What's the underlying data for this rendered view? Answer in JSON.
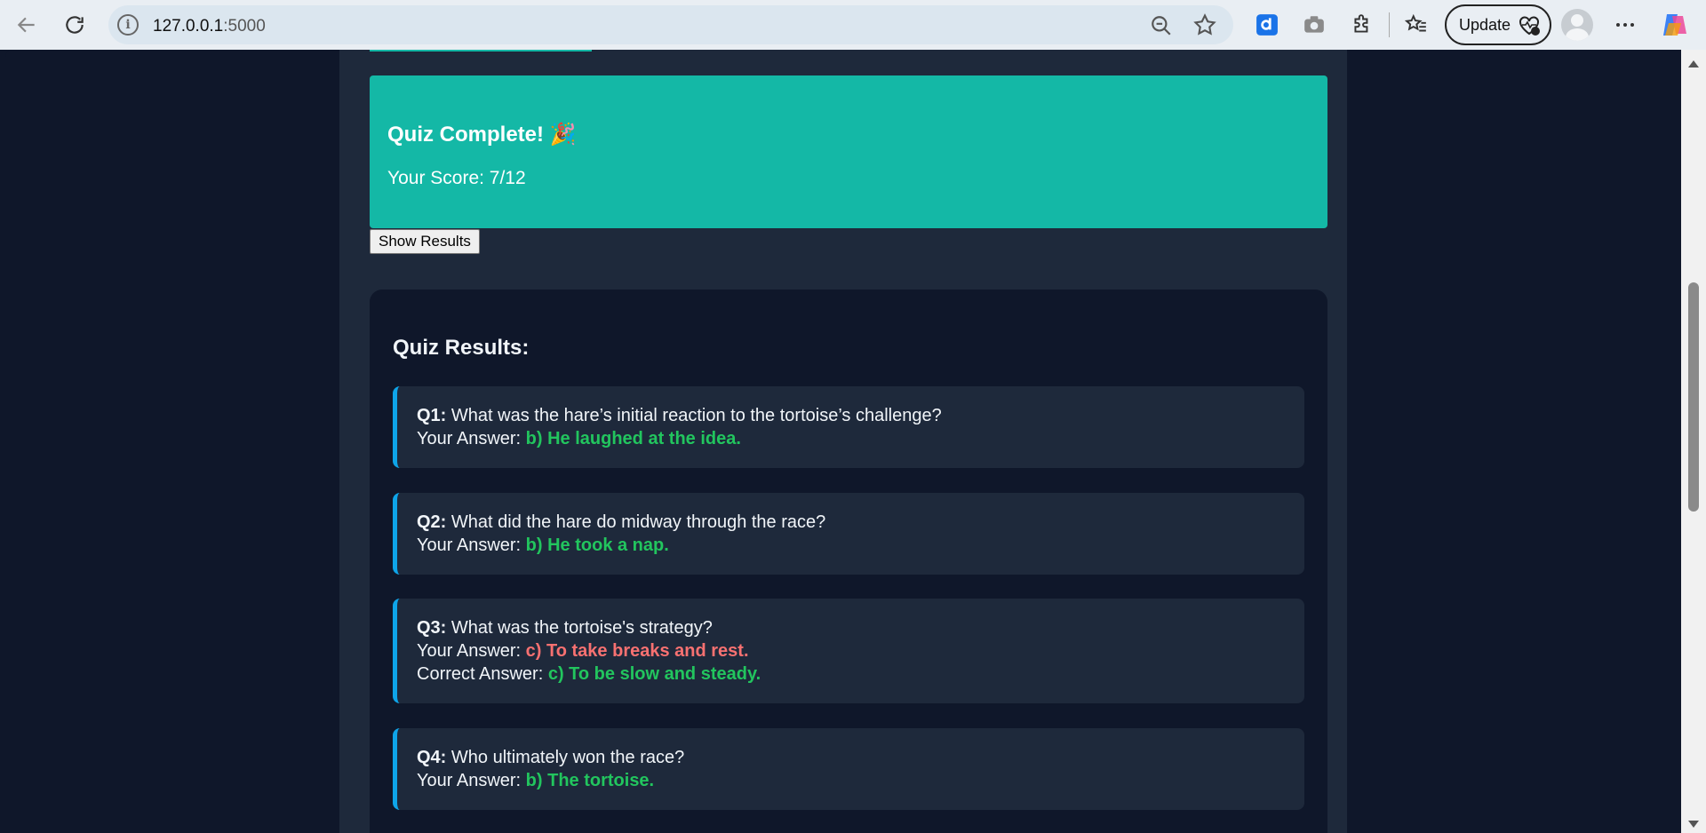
{
  "browser": {
    "url_host": "127.0.0.1",
    "url_port": ":5000",
    "update_label": "Update"
  },
  "quiz": {
    "complete_title": "Quiz Complete! 🎉",
    "score_text": "Your Score: 7/12",
    "show_results_label": "Show Results",
    "results_heading": "Quiz Results:",
    "your_answer_label": "Your Answer:",
    "correct_answer_label": "Correct Answer:",
    "questions": [
      {
        "num": "Q1:",
        "text": "What was the hare’s initial reaction to the tortoise’s challenge?",
        "your_answer": "b) He laughed at the idea."
      },
      {
        "num": "Q2:",
        "text": "What did the hare do midway through the race?",
        "your_answer": "b) He took a nap."
      },
      {
        "num": "Q3:",
        "text": "What was the tortoise's strategy?",
        "your_answer": "c) To take breaks and rest.",
        "correct_answer": "c) To be slow and steady."
      },
      {
        "num": "Q4:",
        "text": "Who ultimately won the race?",
        "your_answer": "b) The tortoise."
      }
    ]
  },
  "colors": {
    "accent": "#14b8a6",
    "correct": "#22c55e",
    "wrong": "#f87171",
    "border": "#0ea5e9"
  }
}
